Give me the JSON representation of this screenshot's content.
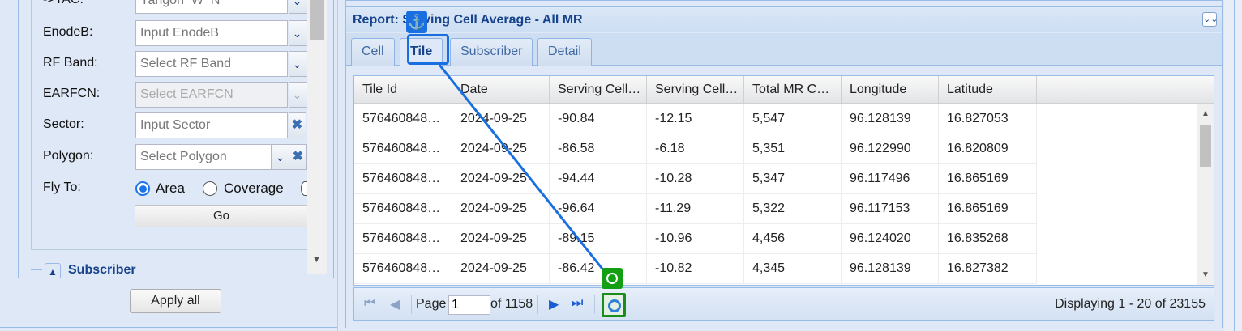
{
  "filters": {
    "tac": {
      "label": "->TAC:",
      "value": "Yangon_W_N"
    },
    "enodeb": {
      "label": "EnodeB:",
      "placeholder": "Input EnodeB"
    },
    "rf_band": {
      "label": "RF Band:",
      "placeholder": "Select RF Band"
    },
    "earfcn": {
      "label": "EARFCN:",
      "placeholder": "Select EARFCN"
    },
    "sector": {
      "label": "Sector:",
      "placeholder": "Input Sector"
    },
    "polygon": {
      "label": "Polygon:",
      "placeholder": "Select Polygon"
    },
    "fly_to": {
      "label": "Fly To:",
      "options": [
        "Area",
        "Coverage"
      ],
      "selected": "Area"
    },
    "go_label": "Go",
    "clear_glyph": "✖",
    "dropdown_glyph": "⌄"
  },
  "subscriber_section": {
    "title": "Subscriber"
  },
  "apply_all_label": "Apply all",
  "report": {
    "title": "Report: Serving Cell Average - All MR",
    "tabs": [
      "Cell",
      "Tile",
      "Subscriber",
      "Detail"
    ],
    "active_tab": "Tile",
    "columns": [
      "Tile Id",
      "Date",
      "Serving Cell…",
      "Serving Cell…",
      "Total MR C…",
      "Longitude",
      "Latitude"
    ],
    "rows": [
      [
        "576460848…",
        "2024-09-25",
        "-90.84",
        "-12.15",
        "5,547",
        "96.128139",
        "16.827053"
      ],
      [
        "576460848…",
        "2024-09-25",
        "-86.58",
        "-6.18",
        "5,351",
        "96.122990",
        "16.820809"
      ],
      [
        "576460848…",
        "2024-09-25",
        "-94.44",
        "-10.28",
        "5,347",
        "96.117496",
        "16.865169"
      ],
      [
        "576460848…",
        "2024-09-25",
        "-96.64",
        "-11.29",
        "5,322",
        "96.117153",
        "16.865169"
      ],
      [
        "576460848…",
        "2024-09-25",
        "-89.15",
        "-10.96",
        "4,456",
        "96.124020",
        "16.835268"
      ],
      [
        "576460848…",
        "2024-09-25",
        "-86.42",
        "-10.82",
        "4,345",
        "96.128139",
        "16.827382"
      ]
    ],
    "pager": {
      "page_label": "Page",
      "page_value": "1",
      "of_label": "of 1158",
      "display_text": "Displaying 1 - 20 of 23155"
    }
  },
  "overlay": {
    "anchor_glyph": "⚓"
  },
  "colors": {
    "accent": "#15428b",
    "panel_bg": "#dfe8f6",
    "border": "#99bbe8",
    "annotation_blue": "#1a6fe0",
    "annotation_green": "#12a012"
  }
}
